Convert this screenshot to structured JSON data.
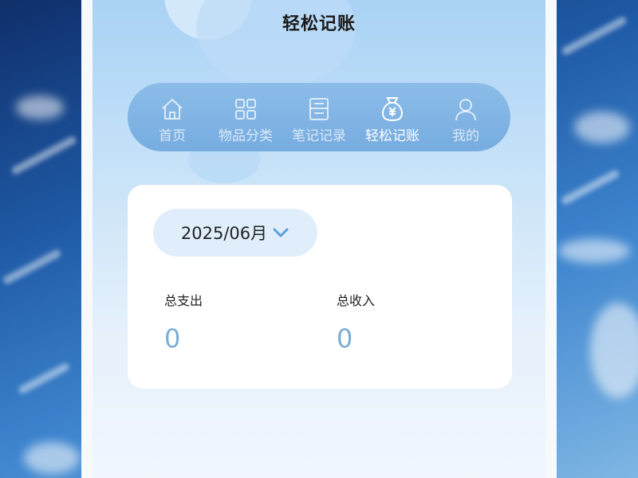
{
  "header": {
    "title": "轻松记账"
  },
  "tabs": [
    {
      "label": "首页",
      "icon": "home-icon",
      "active": false
    },
    {
      "label": "物品分类",
      "icon": "grid-icon",
      "active": false
    },
    {
      "label": "笔记记录",
      "icon": "notebook-icon",
      "active": false
    },
    {
      "label": "轻松记账",
      "icon": "money-bag-icon",
      "active": true
    },
    {
      "label": "我的",
      "icon": "user-icon",
      "active": false
    }
  ],
  "summary": {
    "month": "2025/06月",
    "expense_label": "总支出",
    "expense_value": "0",
    "income_label": "总收入",
    "income_value": "0"
  },
  "colors": {
    "tab_bar": "#7fb3e3",
    "accent_value": "#7aaed6",
    "chevron": "#5a9fdb"
  }
}
